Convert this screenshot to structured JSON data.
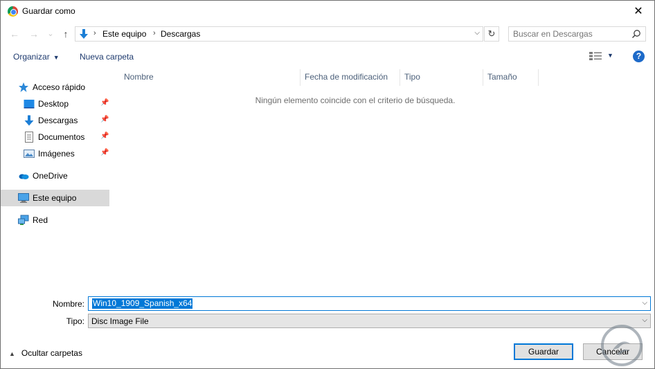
{
  "window": {
    "title": "Guardar como",
    "close_glyph": "✕"
  },
  "nav": {
    "back_glyph": "←",
    "forward_glyph": "→",
    "recent_glyph": "⌄",
    "up_glyph": "↑",
    "breadcrumb": [
      "Este equipo",
      "Descargas"
    ],
    "crumb_sep": "›",
    "refresh_glyph": "↻",
    "search_placeholder": "Buscar en Descargas"
  },
  "toolbar": {
    "organize_label": "Organizar",
    "new_folder_label": "Nueva carpeta",
    "help_glyph": "?"
  },
  "sidebar": {
    "items": [
      {
        "label": "Acceso rápido",
        "icon": "star-icon"
      },
      {
        "label": "Desktop",
        "icon": "desktop-icon",
        "pinned": true
      },
      {
        "label": "Descargas",
        "icon": "downloads-icon",
        "pinned": true
      },
      {
        "label": "Documentos",
        "icon": "documents-icon",
        "pinned": true
      },
      {
        "label": "Imágenes",
        "icon": "pictures-icon",
        "pinned": true
      },
      {
        "label": "OneDrive",
        "icon": "onedrive-icon"
      },
      {
        "label": "Este equipo",
        "icon": "computer-icon",
        "selected": true
      },
      {
        "label": "Red",
        "icon": "network-icon"
      }
    ]
  },
  "filelist": {
    "columns": [
      "Nombre",
      "Fecha de modificación",
      "Tipo",
      "Tamaño"
    ],
    "empty_message": "Ningún elemento coincide con el criterio de búsqueda."
  },
  "form": {
    "name_label": "Nombre:",
    "name_value": "Win10_1909_Spanish_x64",
    "type_label": "Tipo:",
    "type_value": "Disc Image File"
  },
  "footer": {
    "hide_folders_label": "Ocultar carpetas",
    "save_label": "Guardar",
    "cancel_label": "Cancelar"
  },
  "colors": {
    "accent": "#0078d7",
    "link": "#1e3a6e",
    "selection": "#d9d9d9"
  }
}
